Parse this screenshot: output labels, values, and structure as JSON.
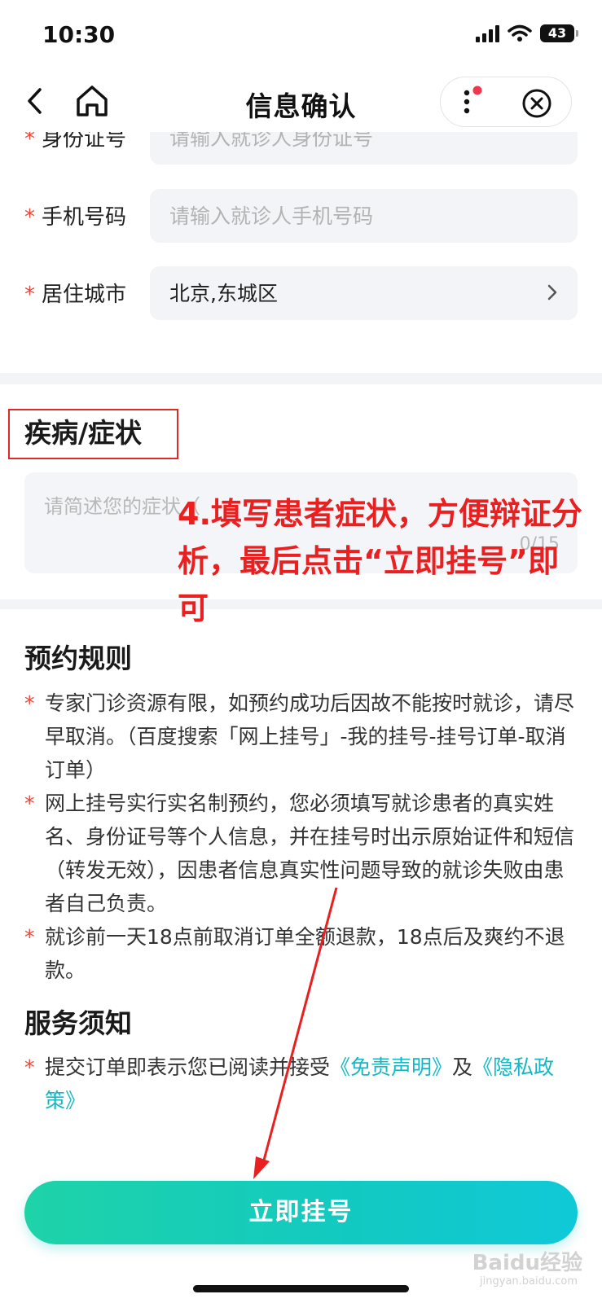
{
  "status_bar": {
    "time": "10:30",
    "battery": "43"
  },
  "nav": {
    "title": "信息确认"
  },
  "form": {
    "required_mark": "*",
    "id_label": "身份证号",
    "id_placeholder": "请输入就诊人身份证号",
    "phone_label": "手机号码",
    "phone_placeholder": "请输入就诊人手机号码",
    "city_label": "居住城市",
    "city_value": "北京,东城区"
  },
  "disease": {
    "title": "疾病/症状",
    "placeholder": "请简述您的症状（",
    "counter": "0/15"
  },
  "annotation": {
    "text": "4.填写患者症状，方便辩证分析，最后点击“立即挂号”即可"
  },
  "rules": {
    "title": "预约规则",
    "items": [
      "专家门诊资源有限，如预约成功后因故不能按时就诊，请尽早取消。（百度搜索「网上挂号」-我的挂号-挂号订单-取消订单）",
      "网上挂号实行实名制预约，您必须填写就诊患者的真实姓名、身份证号等个人信息，并在挂号时出示原始证件和短信（转发无效），因患者信息真实性问题导致的就诊失败由患者自己负责。",
      "就诊前一天18点前取消订单全额退款，18点后及爽约不退款。"
    ]
  },
  "service": {
    "title": "服务须知",
    "text_before": "提交订单即表示您已阅读并接受",
    "disclaimer_link": "《免责声明》",
    "conjunction": "及",
    "privacy_link": "《隐私政策》"
  },
  "submit": {
    "label": "立即挂号"
  },
  "watermark": {
    "brand": "Baidu经验",
    "site": "jingyan.baidu.com"
  },
  "colors": {
    "required_star": "#e84a3c",
    "link": "#14b8c4",
    "annotation_red": "#ea2020",
    "button_gradient_start": "#1ed3a8",
    "button_gradient_end": "#10c9d7"
  },
  "icons": {
    "back": "chevron-left-icon",
    "home": "home-icon",
    "more": "more-vertical-icon",
    "close": "close-circle-icon",
    "city_arrow": "chevron-right-icon"
  }
}
